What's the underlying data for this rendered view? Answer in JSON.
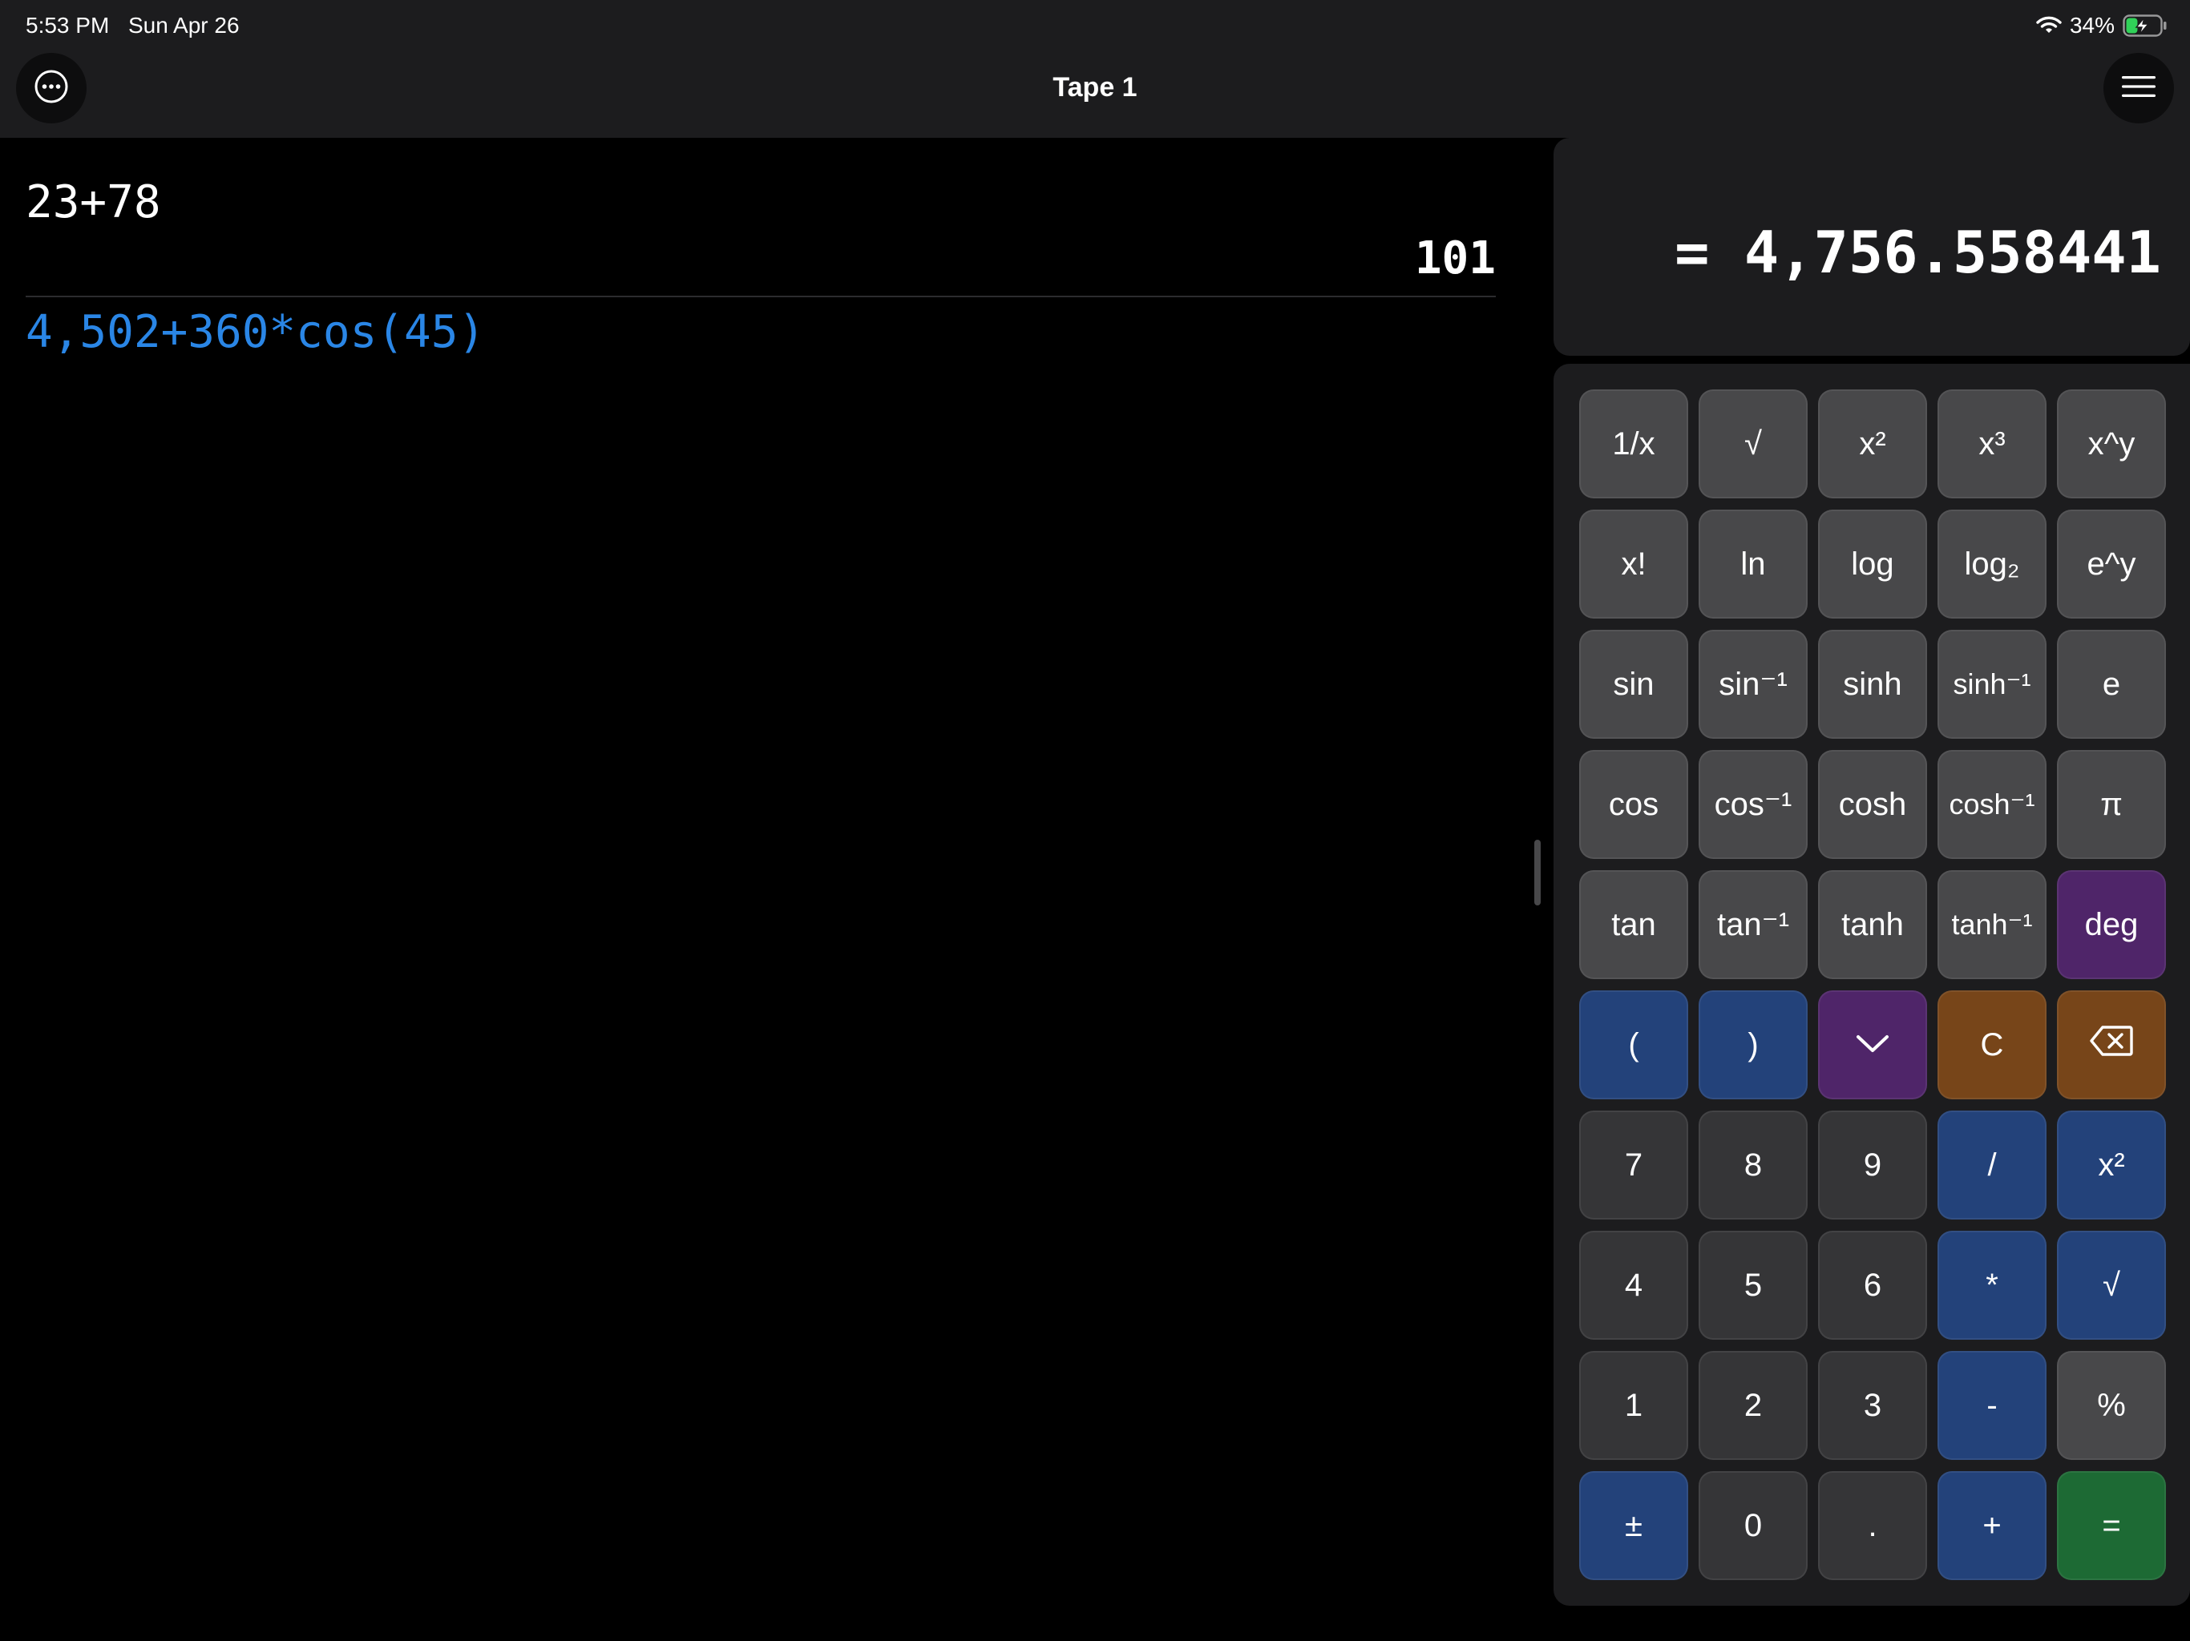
{
  "status_bar": {
    "time": "5:53 PM",
    "date": "Sun Apr 26",
    "battery_percent": "34%",
    "battery_level": 0.34,
    "charging": true,
    "wifi_icon": "wifi-icon",
    "battery_icon": "battery-charging-icon"
  },
  "header": {
    "title": "Tape 1",
    "more_icon": "ellipsis-circle-icon",
    "menu_icon": "hamburger-menu-icon"
  },
  "tape": {
    "entries": [
      {
        "expression": "23+78",
        "result": "101"
      }
    ],
    "current_expression": "4,502+360*cos(45)"
  },
  "display": {
    "result": "= 4,756.558441"
  },
  "colors": {
    "background": "#000000",
    "panel": "#1c1c1e",
    "current_expression": "#2a86e6",
    "key_gray": "#48484a",
    "key_dark": "#353537",
    "key_blue": "#23427a",
    "key_purple": "#4f2569",
    "key_orange": "#774519",
    "key_green": "#1d6a34"
  },
  "keypad": {
    "rows": [
      [
        {
          "label": "1/x",
          "color": "gray"
        },
        {
          "label": "√",
          "color": "gray"
        },
        {
          "label": "x²",
          "color": "gray"
        },
        {
          "label": "x³",
          "color": "gray"
        },
        {
          "label": "x^y",
          "color": "gray"
        }
      ],
      [
        {
          "label": "x!",
          "color": "gray"
        },
        {
          "label": "ln",
          "color": "gray"
        },
        {
          "label": "log",
          "color": "gray"
        },
        {
          "label": "log₂",
          "color": "gray"
        },
        {
          "label": "e^y",
          "color": "gray"
        }
      ],
      [
        {
          "label": "sin",
          "color": "gray"
        },
        {
          "label": "sin⁻¹",
          "color": "gray"
        },
        {
          "label": "sinh",
          "color": "gray"
        },
        {
          "label": "sinh⁻¹",
          "color": "gray"
        },
        {
          "label": "e",
          "color": "gray"
        }
      ],
      [
        {
          "label": "cos",
          "color": "gray"
        },
        {
          "label": "cos⁻¹",
          "color": "gray"
        },
        {
          "label": "cosh",
          "color": "gray"
        },
        {
          "label": "cosh⁻¹",
          "color": "gray"
        },
        {
          "label": "π",
          "color": "gray"
        }
      ],
      [
        {
          "label": "tan",
          "color": "gray"
        },
        {
          "label": "tan⁻¹",
          "color": "gray"
        },
        {
          "label": "tanh",
          "color": "gray"
        },
        {
          "label": "tanh⁻¹",
          "color": "gray"
        },
        {
          "label": "deg",
          "color": "purple"
        }
      ],
      [
        {
          "label": "(",
          "color": "blue"
        },
        {
          "label": ")",
          "color": "blue"
        },
        {
          "label": "",
          "icon": "chevron-down-icon",
          "color": "purple"
        },
        {
          "label": "C",
          "color": "orange"
        },
        {
          "label": "",
          "icon": "backspace-icon",
          "color": "orange"
        }
      ],
      [
        {
          "label": "7",
          "color": "dark"
        },
        {
          "label": "8",
          "color": "dark"
        },
        {
          "label": "9",
          "color": "dark"
        },
        {
          "label": "/",
          "color": "blue"
        },
        {
          "label": "x²",
          "color": "blue"
        }
      ],
      [
        {
          "label": "4",
          "color": "dark"
        },
        {
          "label": "5",
          "color": "dark"
        },
        {
          "label": "6",
          "color": "dark"
        },
        {
          "label": "*",
          "color": "blue"
        },
        {
          "label": "√",
          "color": "blue"
        }
      ],
      [
        {
          "label": "1",
          "color": "dark"
        },
        {
          "label": "2",
          "color": "dark"
        },
        {
          "label": "3",
          "color": "dark"
        },
        {
          "label": "-",
          "color": "blue"
        },
        {
          "label": "%",
          "color": "gray"
        }
      ],
      [
        {
          "label": "±",
          "color": "blue"
        },
        {
          "label": "0",
          "color": "dark"
        },
        {
          "label": ".",
          "color": "dark"
        },
        {
          "label": "+",
          "color": "blue"
        },
        {
          "label": "=",
          "color": "green"
        }
      ]
    ]
  }
}
